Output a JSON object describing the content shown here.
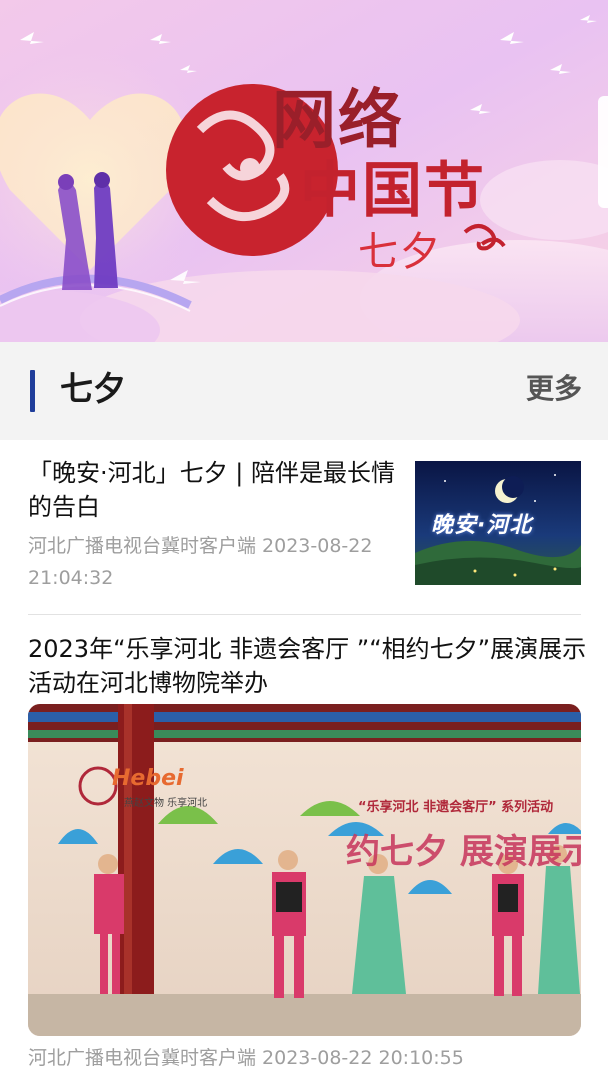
{
  "banner": {
    "title_line1": "网络",
    "title_line2": "中国节",
    "title_line3": "七夕"
  },
  "section": {
    "title": "七夕",
    "more_label": "更多"
  },
  "articles": [
    {
      "title": "「晚安·河北」七夕 | 陪伴是最长情的告白",
      "source": "河北广播电视台冀时客户端",
      "date": "2023-08-22",
      "time": "21:04:32",
      "meta": "河北广播电视台冀时客户端 2023-08-22 21:04:32",
      "thumbnail_text": "晚安·河北"
    },
    {
      "title": "2023年“乐享河北 非遗会客厅 ”“相约七夕”展演展示活动在河北博物院举办",
      "meta": "河北广播电视台冀时客户端 2023-08-22 20:10:55",
      "poster_subtitle": "“乐享河北  非遗会客厅” 系列活动",
      "poster_headline": "约七夕 展演展示活动",
      "poster_brand": "Hebei",
      "poster_brand_sub": "燕赵文物 乐享河北"
    }
  ],
  "colors": {
    "accent_bar": "#1f3d9a",
    "meta_text": "#9e9e9e",
    "section_bg": "#f3f3f3",
    "banner_red": "#c3222e"
  }
}
